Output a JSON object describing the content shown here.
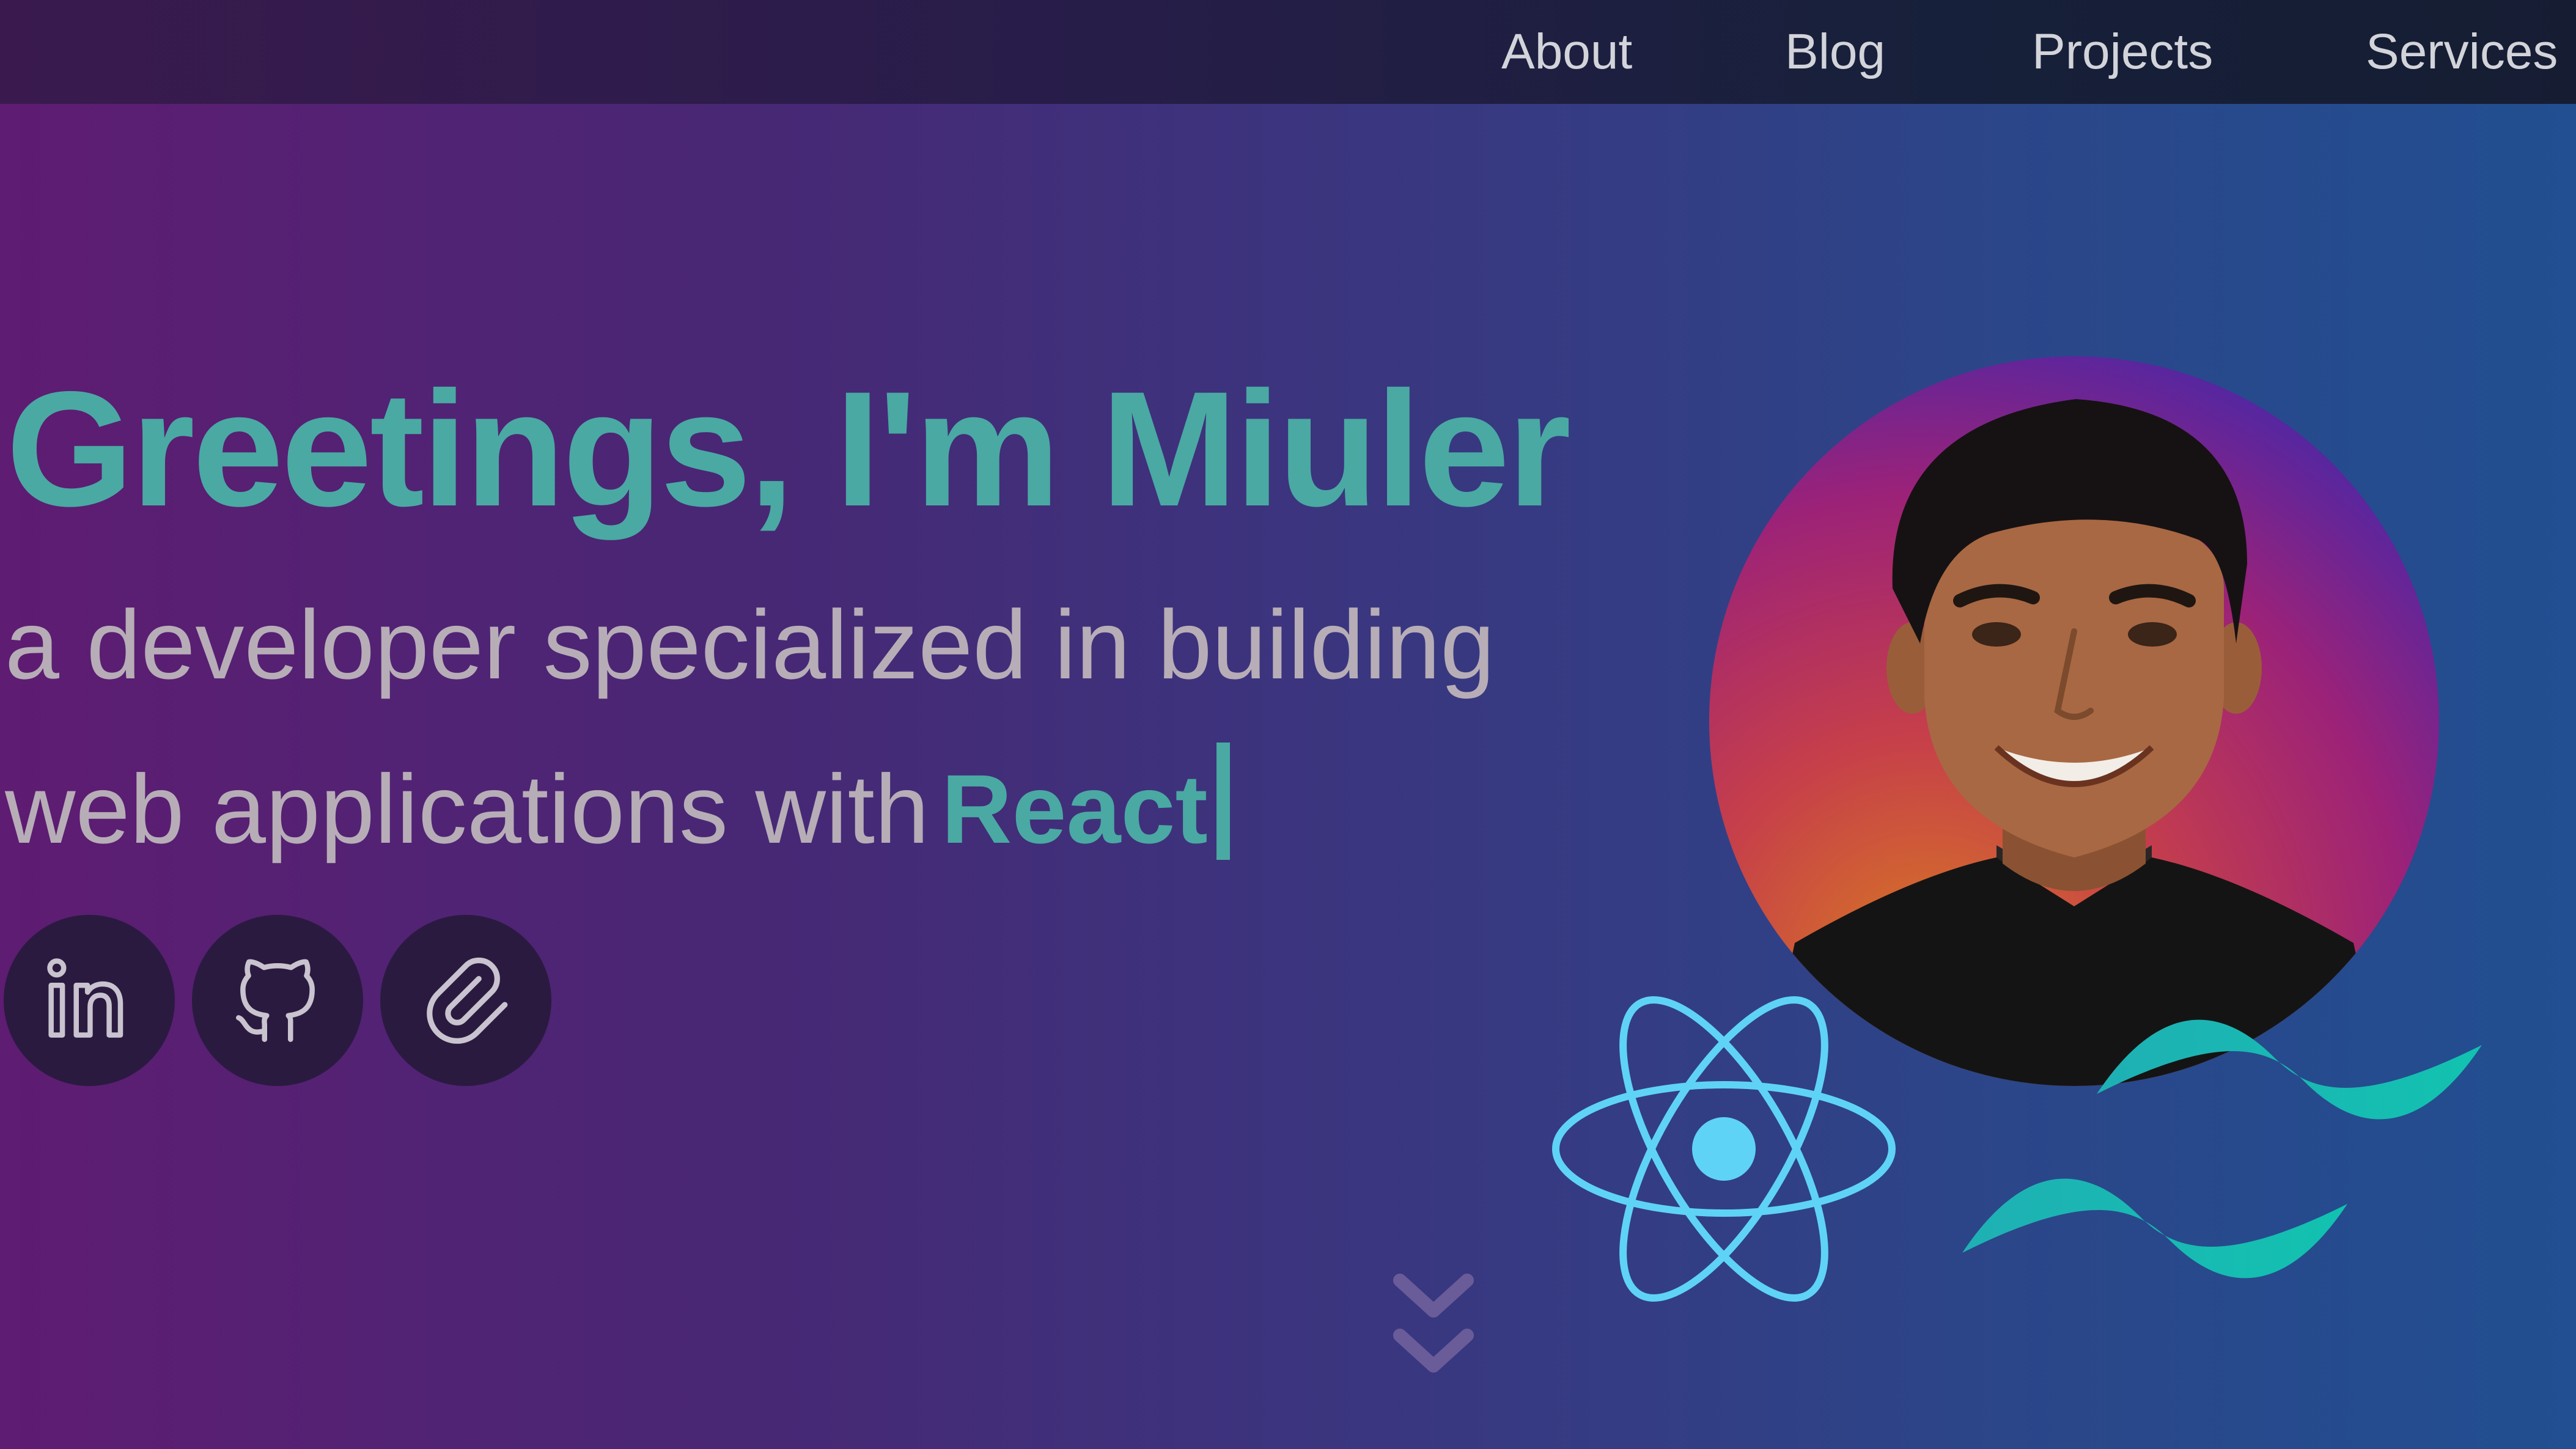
{
  "nav": {
    "items": [
      {
        "label": "About"
      },
      {
        "label": "Blog"
      },
      {
        "label": "Projects"
      },
      {
        "label": "Services"
      }
    ]
  },
  "hero": {
    "greeting": "Greetings, I'm Miuler",
    "subtitle_line1": "a developer specialized in building",
    "subtitle_line2": "web applications with",
    "highlight_tech": "React"
  },
  "social": [
    {
      "icon": "linkedin-icon"
    },
    {
      "icon": "github-icon"
    },
    {
      "icon": "paperclip-icon"
    }
  ],
  "floating_icons": [
    "react-logo",
    "tailwind-logo"
  ],
  "scroll_indicator": {
    "icon": "double-chevron-down-icon"
  },
  "colors": {
    "accent": "#4aa9a3",
    "subtitle": "#b7adb7",
    "nav_text": "#d2d4da",
    "react_blue": "#5fd3f5",
    "tailwind_teal": "#16b5b5",
    "social_bg": "#2a1a40"
  }
}
